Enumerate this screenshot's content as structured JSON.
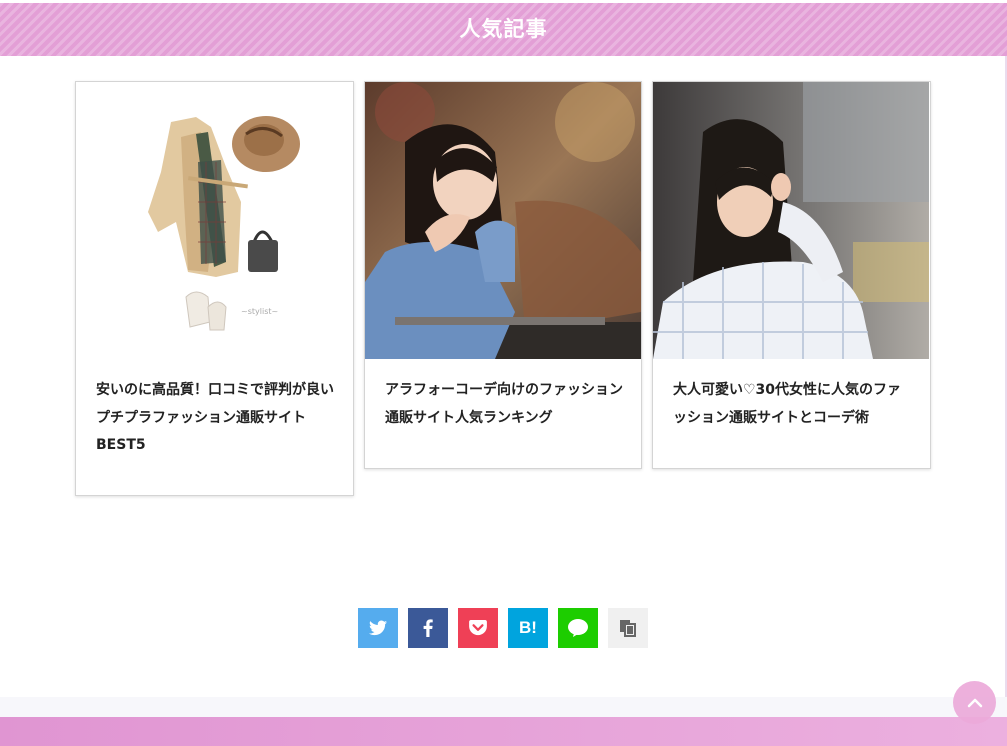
{
  "section": {
    "title": "人気記事"
  },
  "articles": [
    {
      "title": "安いのに高品質！口コミで評判が良いプチプラファッション通販サイトBEST5",
      "thumb": "trench-coat-outfit-image"
    },
    {
      "title": "アラフォーコーデ向けのファッション通販サイト人気ランキング",
      "thumb": "smiling-woman-denim-shirt-photo"
    },
    {
      "title": "大人可愛い♡30代女性に人気のファッション通販サイトとコーデ術",
      "thumb": "woman-checked-blouse-photo"
    }
  ],
  "share": [
    {
      "name": "twitter",
      "icon": "twitter-icon",
      "color": "#55acee"
    },
    {
      "name": "facebook",
      "icon": "facebook-icon",
      "color": "#3b5998"
    },
    {
      "name": "pocket",
      "icon": "pocket-icon",
      "color": "#ef4056"
    },
    {
      "name": "hatena",
      "icon": "hatena-bookmark-icon",
      "color": "#00a4de",
      "label": "B!"
    },
    {
      "name": "line",
      "icon": "line-icon",
      "color": "#1dcd00"
    },
    {
      "name": "copy",
      "icon": "copy-icon",
      "color": "#f0f0f0"
    }
  ],
  "colors": {
    "accent": "#e39fd6",
    "footer": "#e39fd6"
  }
}
